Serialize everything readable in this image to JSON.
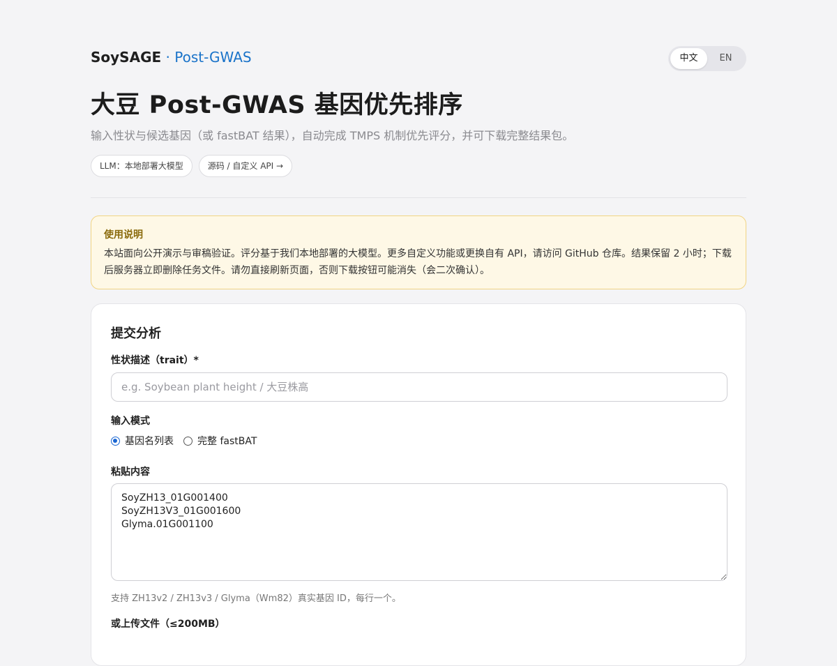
{
  "header": {
    "brand_main": "SoySAGE",
    "brand_sep": " · ",
    "brand_sub": "Post-GWAS",
    "lang_options": [
      "中文",
      "EN"
    ],
    "lang_active": "中文"
  },
  "hero": {
    "title": "大豆 Post-GWAS 基因优先排序",
    "subtitle": "输入性状与候选基因（或 fastBAT 结果），自动完成 TMPS 机制优先评分，并可下载完整结果包。",
    "chip_llm": "LLM：本地部署大模型",
    "chip_source": "源码 / 自定义 API →"
  },
  "notice": {
    "title": "使用说明",
    "body": "本站面向公开演示与审稿验证。评分基于我们本地部署的大模型。更多自定义功能或更换自有 API，请访问 GitHub 仓库。结果保留 2 小时；下载后服务器立即删除任务文件。请勿直接刷新页面，否则下载按钮可能消失（会二次确认）。"
  },
  "form": {
    "title": "提交分析",
    "trait_label": "性状描述（trait）*",
    "trait_placeholder": "e.g. Soybean plant height / 大豆株高",
    "trait_value": "",
    "mode_label": "输入模式",
    "mode_options": [
      "基因名列表",
      "完整 fastBAT"
    ],
    "mode_selected": "基因名列表",
    "paste_label": "粘贴内容",
    "paste_value": "SoyZH13_01G001400\nSoyZH13V3_01G001600\nGlyma.01G001100",
    "paste_hint": "支持 ZH13v2 / ZH13v3 / Glyma（Wm82）真实基因 ID，每行一个。",
    "upload_label": "或上传文件（≤200MB）"
  }
}
